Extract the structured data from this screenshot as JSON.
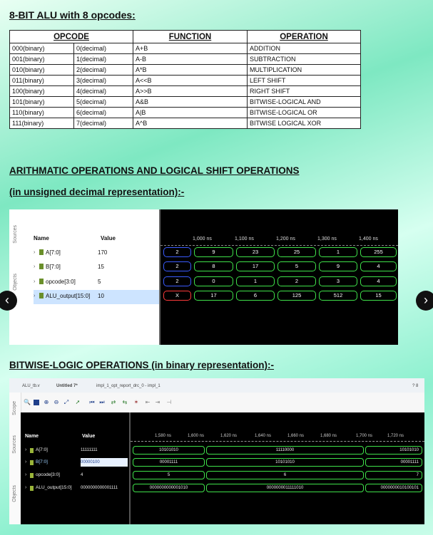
{
  "title": "8-BIT ALU with 8 opcodes:",
  "table": {
    "headers": [
      "OPCODE",
      "FUNCTION",
      "OPERATION"
    ],
    "rows": [
      {
        "bin": "000(binary)",
        "dec": "0(decimal)",
        "fn": "A+B",
        "op": "ADDITION"
      },
      {
        "bin": "001(binary)",
        "dec": "1(decimal)",
        "fn": "A-B",
        "op": "SUBTRACTION"
      },
      {
        "bin": "010(binary)",
        "dec": "2(decimal)",
        "fn": "A*B",
        "op": "MULTIPLICATION"
      },
      {
        "bin": "011(binary)",
        "dec": "3(decimal)",
        "fn": "A<<B",
        "op": "LEFT SHIFT"
      },
      {
        "bin": "100(binary)",
        "dec": "4(decimal)",
        "fn": "A>>B",
        "op": "RIGHT SHIFT"
      },
      {
        "bin": "101(binary)",
        "dec": "5(decimal)",
        "fn": "A&B",
        "op": "BITWISE-LOGICAL AND"
      },
      {
        "bin": "110(binary)",
        "dec": "6(decimal)",
        "fn": "A|B",
        "op": "BITWISE-LOGICAL OR"
      },
      {
        "bin": "111(binary)",
        "dec": "7(decimal)",
        "fn": "A^B",
        "op": "BITWISE LOGICAL XOR"
      }
    ]
  },
  "section1": {
    "line1": "ARITHMATIC OPERATIONS AND LOGICAL SHIFT OPERATIONS",
    "line2": "(in unsigned decimal representation):-"
  },
  "section2": "BITWISE-LOGIC OPERATIONS (in binary representation):-",
  "wave1": {
    "side_tabs": [
      "Sources",
      "Objects"
    ],
    "name_header": "Name",
    "value_header": "Value",
    "time_labels": [
      "1,000 ns",
      "1,100 ns",
      "1,200 ns",
      "1,300 ns",
      "1,400 ns"
    ],
    "signals": [
      {
        "name": "A[7:0]",
        "value": "170",
        "segments": [
          "2",
          "9",
          "23",
          "25",
          "1",
          "255"
        ]
      },
      {
        "name": "B[7:0]",
        "value": "15",
        "segments": [
          "2",
          "8",
          "17",
          "5",
          "9",
          "4"
        ]
      },
      {
        "name": "opcode[3:0]",
        "value": "5",
        "segments": [
          "2",
          "0",
          "1",
          "2",
          "3",
          "4"
        ]
      },
      {
        "name": "ALU_output[15:0]",
        "value": "10",
        "segments": [
          "X",
          "17",
          "6",
          "125",
          "512",
          "15"
        ]
      }
    ]
  },
  "wave2": {
    "tabs": [
      "ALU_tb.v",
      "Untitled 7*",
      "impl_1_opt_report_drc_0 - impl_1"
    ],
    "side_tabs": [
      "Scope",
      "Sources",
      "Objects"
    ],
    "corner": "? 8",
    "name_header": "Name",
    "value_header": "Value",
    "time_labels": [
      "1,580 ns",
      "1,600 ns",
      "1,620 ns",
      "1,640 ns",
      "1,660 ns",
      "1,680 ns",
      "1,700 ns",
      "1,720 ns"
    ],
    "signals": [
      {
        "name": "A[7:0]",
        "value": "11111111",
        "segments": [
          "10101010",
          "11110000",
          "10101010"
        ]
      },
      {
        "name": "B[7:0]",
        "value": "00000100",
        "segments": [
          "00001111",
          "10101010",
          "00001111"
        ]
      },
      {
        "name": "opcode[3:0]",
        "value": "4",
        "segments": [
          "5",
          "6",
          "7"
        ]
      },
      {
        "name": "ALU_output[15:0]",
        "value": "0000000000001111",
        "segments": [
          "0000000000001010",
          "0000000011111010",
          "0000000010100101"
        ]
      }
    ]
  },
  "nav": {
    "prev": "‹",
    "next": "›"
  }
}
